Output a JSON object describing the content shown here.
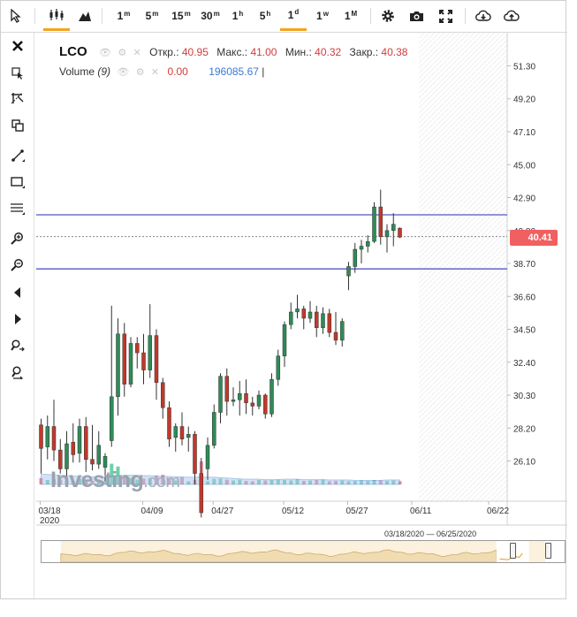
{
  "toolbar": {
    "timeframes": [
      {
        "base": "1",
        "unit": "m"
      },
      {
        "base": "5",
        "unit": "m"
      },
      {
        "base": "15",
        "unit": "m"
      },
      {
        "base": "30",
        "unit": "m"
      },
      {
        "base": "1",
        "unit": "h"
      },
      {
        "base": "5",
        "unit": "h"
      },
      {
        "base": "1",
        "unit": "d"
      },
      {
        "base": "1",
        "unit": "w"
      },
      {
        "base": "1",
        "unit": "M"
      }
    ],
    "active_timeframe": "1d"
  },
  "legend": {
    "symbol": "LCO",
    "open_label": "Откр.:",
    "open": "40.95",
    "high_label": "Макс.:",
    "high": "41.00",
    "low_label": "Мин.:",
    "low": "40.32",
    "close_label": "Закр.:",
    "close": "40.38",
    "volume_label": "Volume",
    "volume_period": "(9)",
    "volume_value": "0.00",
    "volume_ma": "196085.67"
  },
  "logo": {
    "main": "Investing",
    "suffix": ".com"
  },
  "price_badge": "40.41",
  "navigator": {
    "range_label": "03/18/2020 — 06/25/2020"
  },
  "colors": {
    "up": "#2e8b57",
    "down": "#c0392b",
    "level_line": "#5555c8",
    "badge": "#f06060",
    "accent": "#f3a41c"
  },
  "chart_data": {
    "type": "candlestick",
    "ylim": [
      24.0,
      53.0
    ],
    "y_ticks": [
      "51.30",
      "49.20",
      "47.10",
      "45.00",
      "42.90",
      "40.80",
      "38.70",
      "36.60",
      "34.50",
      "32.40",
      "30.30",
      "28.20",
      "26.10"
    ],
    "x_tick_labels": [
      "03/18",
      "04/09",
      "04/27",
      "05/12",
      "05/27",
      "06/11",
      "06/22"
    ],
    "x_year_label": "2020",
    "horizontal_levels": [
      41.8,
      38.35
    ],
    "last_price": 40.41,
    "candles": [
      {
        "o": 28.4,
        "h": 28.8,
        "l": 25.3,
        "c": 26.9
      },
      {
        "o": 27.0,
        "h": 29.0,
        "l": 26.2,
        "c": 28.3
      },
      {
        "o": 28.3,
        "h": 30.0,
        "l": 26.1,
        "c": 26.8
      },
      {
        "o": 26.8,
        "h": 27.5,
        "l": 25.3,
        "c": 25.6
      },
      {
        "o": 25.6,
        "h": 28.0,
        "l": 24.9,
        "c": 27.2
      },
      {
        "o": 27.3,
        "h": 28.5,
        "l": 26.0,
        "c": 26.5
      },
      {
        "o": 26.6,
        "h": 28.8,
        "l": 26.0,
        "c": 28.3
      },
      {
        "o": 28.3,
        "h": 28.9,
        "l": 25.4,
        "c": 26.2
      },
      {
        "o": 26.2,
        "h": 28.4,
        "l": 25.5,
        "c": 25.9
      },
      {
        "o": 25.9,
        "h": 28.0,
        "l": 25.6,
        "c": 27.1
      },
      {
        "o": 25.7,
        "h": 26.6,
        "l": 24.8,
        "c": 26.4
      },
      {
        "o": 27.4,
        "h": 36.0,
        "l": 27.0,
        "c": 30.2
      },
      {
        "o": 30.2,
        "h": 35.2,
        "l": 29.0,
        "c": 34.2
      },
      {
        "o": 34.2,
        "h": 34.9,
        "l": 30.2,
        "c": 31.0
      },
      {
        "o": 31.0,
        "h": 34.0,
        "l": 30.8,
        "c": 33.6
      },
      {
        "o": 33.6,
        "h": 34.0,
        "l": 32.0,
        "c": 33.0
      },
      {
        "o": 33.0,
        "h": 34.2,
        "l": 31.0,
        "c": 31.9
      },
      {
        "o": 31.9,
        "h": 36.1,
        "l": 31.4,
        "c": 34.1
      },
      {
        "o": 34.1,
        "h": 34.5,
        "l": 30.0,
        "c": 31.1
      },
      {
        "o": 31.1,
        "h": 31.4,
        "l": 28.8,
        "c": 29.5
      },
      {
        "o": 29.5,
        "h": 29.9,
        "l": 27.0,
        "c": 27.5
      },
      {
        "o": 27.6,
        "h": 28.5,
        "l": 26.7,
        "c": 28.3
      },
      {
        "o": 28.3,
        "h": 29.2,
        "l": 27.1,
        "c": 27.5
      },
      {
        "o": 27.6,
        "h": 28.3,
        "l": 26.7,
        "c": 27.8
      },
      {
        "o": 27.8,
        "h": 28.0,
        "l": 24.6,
        "c": 25.3
      },
      {
        "o": 25.3,
        "h": 26.3,
        "l": 22.5,
        "c": 22.8
      },
      {
        "o": 25.6,
        "h": 27.6,
        "l": 24.9,
        "c": 27.1
      },
      {
        "o": 27.1,
        "h": 29.7,
        "l": 26.9,
        "c": 29.2
      },
      {
        "o": 29.2,
        "h": 31.7,
        "l": 28.5,
        "c": 31.5
      },
      {
        "o": 31.5,
        "h": 32.0,
        "l": 29.0,
        "c": 29.9
      },
      {
        "o": 29.9,
        "h": 30.8,
        "l": 29.6,
        "c": 30.0
      },
      {
        "o": 30.0,
        "h": 31.2,
        "l": 29.0,
        "c": 30.4
      },
      {
        "o": 30.4,
        "h": 31.3,
        "l": 29.1,
        "c": 29.8
      },
      {
        "o": 29.8,
        "h": 30.2,
        "l": 29.0,
        "c": 29.6
      },
      {
        "o": 29.6,
        "h": 30.6,
        "l": 29.4,
        "c": 30.3
      },
      {
        "o": 30.3,
        "h": 30.4,
        "l": 28.8,
        "c": 29.1
      },
      {
        "o": 29.1,
        "h": 31.7,
        "l": 28.9,
        "c": 31.3
      },
      {
        "o": 31.3,
        "h": 33.2,
        "l": 30.9,
        "c": 32.8
      },
      {
        "o": 32.8,
        "h": 35.0,
        "l": 32.1,
        "c": 34.8
      },
      {
        "o": 34.8,
        "h": 36.2,
        "l": 34.5,
        "c": 35.6
      },
      {
        "o": 35.6,
        "h": 36.7,
        "l": 35.2,
        "c": 35.8
      },
      {
        "o": 35.8,
        "h": 36.0,
        "l": 34.5,
        "c": 35.2
      },
      {
        "o": 35.2,
        "h": 36.3,
        "l": 34.9,
        "c": 35.6
      },
      {
        "o": 35.6,
        "h": 36.0,
        "l": 34.0,
        "c": 34.6
      },
      {
        "o": 34.6,
        "h": 35.9,
        "l": 34.2,
        "c": 35.5
      },
      {
        "o": 35.5,
        "h": 35.8,
        "l": 34.0,
        "c": 34.3
      },
      {
        "o": 34.3,
        "h": 35.6,
        "l": 33.5,
        "c": 33.8
      },
      {
        "o": 33.8,
        "h": 35.2,
        "l": 33.4,
        "c": 35.0
      },
      {
        "o": 37.9,
        "h": 38.8,
        "l": 37.0,
        "c": 38.5
      },
      {
        "o": 38.5,
        "h": 40.0,
        "l": 38.1,
        "c": 39.6
      },
      {
        "o": 39.6,
        "h": 40.2,
        "l": 38.7,
        "c": 39.8
      },
      {
        "o": 39.8,
        "h": 40.5,
        "l": 39.4,
        "c": 40.1
      },
      {
        "o": 40.1,
        "h": 42.6,
        "l": 40.0,
        "c": 42.3
      },
      {
        "o": 42.3,
        "h": 43.4,
        "l": 39.9,
        "c": 40.4
      },
      {
        "o": 40.4,
        "h": 41.2,
        "l": 39.4,
        "c": 40.8
      },
      {
        "o": 40.8,
        "h": 41.9,
        "l": 39.8,
        "c": 41.2
      },
      {
        "o": 40.95,
        "h": 41.0,
        "l": 40.32,
        "c": 40.38
      }
    ],
    "volume": [
      {
        "v": 16,
        "up": false
      },
      {
        "v": 11,
        "up": true
      },
      {
        "v": 13,
        "up": false
      },
      {
        "v": 12,
        "up": false
      },
      {
        "v": 9,
        "up": true
      },
      {
        "v": 8,
        "up": false
      },
      {
        "v": 14,
        "up": true
      },
      {
        "v": 10,
        "up": false
      },
      {
        "v": 9,
        "up": false
      },
      {
        "v": 11,
        "up": true
      },
      {
        "v": 7,
        "up": true
      },
      {
        "v": 52,
        "up": true
      },
      {
        "v": 45,
        "up": true
      },
      {
        "v": 20,
        "up": false
      },
      {
        "v": 16,
        "up": true
      },
      {
        "v": 12,
        "up": true
      },
      {
        "v": 15,
        "up": false
      },
      {
        "v": 16,
        "up": true
      },
      {
        "v": 22,
        "up": false
      },
      {
        "v": 24,
        "up": false
      },
      {
        "v": 15,
        "up": false
      },
      {
        "v": 10,
        "up": true
      },
      {
        "v": 18,
        "up": false
      },
      {
        "v": 8,
        "up": true
      },
      {
        "v": 12,
        "up": false
      },
      {
        "v": 58,
        "up": false
      },
      {
        "v": 8,
        "up": true
      },
      {
        "v": 14,
        "up": true
      },
      {
        "v": 15,
        "up": true
      },
      {
        "v": 12,
        "up": false
      },
      {
        "v": 10,
        "up": true
      },
      {
        "v": 12,
        "up": true
      },
      {
        "v": 9,
        "up": false
      },
      {
        "v": 8,
        "up": false
      },
      {
        "v": 11,
        "up": true
      },
      {
        "v": 10,
        "up": false
      },
      {
        "v": 11,
        "up": true
      },
      {
        "v": 12,
        "up": true
      },
      {
        "v": 11,
        "up": true
      },
      {
        "v": 10,
        "up": true
      },
      {
        "v": 13,
        "up": true
      },
      {
        "v": 9,
        "up": false
      },
      {
        "v": 10,
        "up": true
      },
      {
        "v": 11,
        "up": false
      },
      {
        "v": 12,
        "up": true
      },
      {
        "v": 8,
        "up": false
      },
      {
        "v": 9,
        "up": false
      },
      {
        "v": 10,
        "up": true
      },
      {
        "v": 8,
        "up": true
      },
      {
        "v": 9,
        "up": true
      },
      {
        "v": 10,
        "up": true
      },
      {
        "v": 9,
        "up": true
      },
      {
        "v": 11,
        "up": true
      },
      {
        "v": 10,
        "up": false
      },
      {
        "v": 9,
        "up": true
      },
      {
        "v": 10,
        "up": true
      },
      {
        "v": 8,
        "up": false
      }
    ],
    "volume_ma": [
      26,
      25,
      24,
      23,
      22,
      21,
      20,
      20,
      19,
      19,
      18,
      20,
      22,
      23,
      23,
      23,
      22,
      22,
      21,
      20,
      20,
      19,
      19,
      18,
      18,
      19,
      18,
      18,
      17,
      16,
      15,
      14,
      13,
      13,
      13,
      12,
      12,
      12,
      13,
      13,
      13,
      12,
      12,
      12,
      12,
      11,
      11,
      11,
      11,
      10,
      10,
      10,
      10,
      10,
      11,
      11,
      11
    ]
  }
}
